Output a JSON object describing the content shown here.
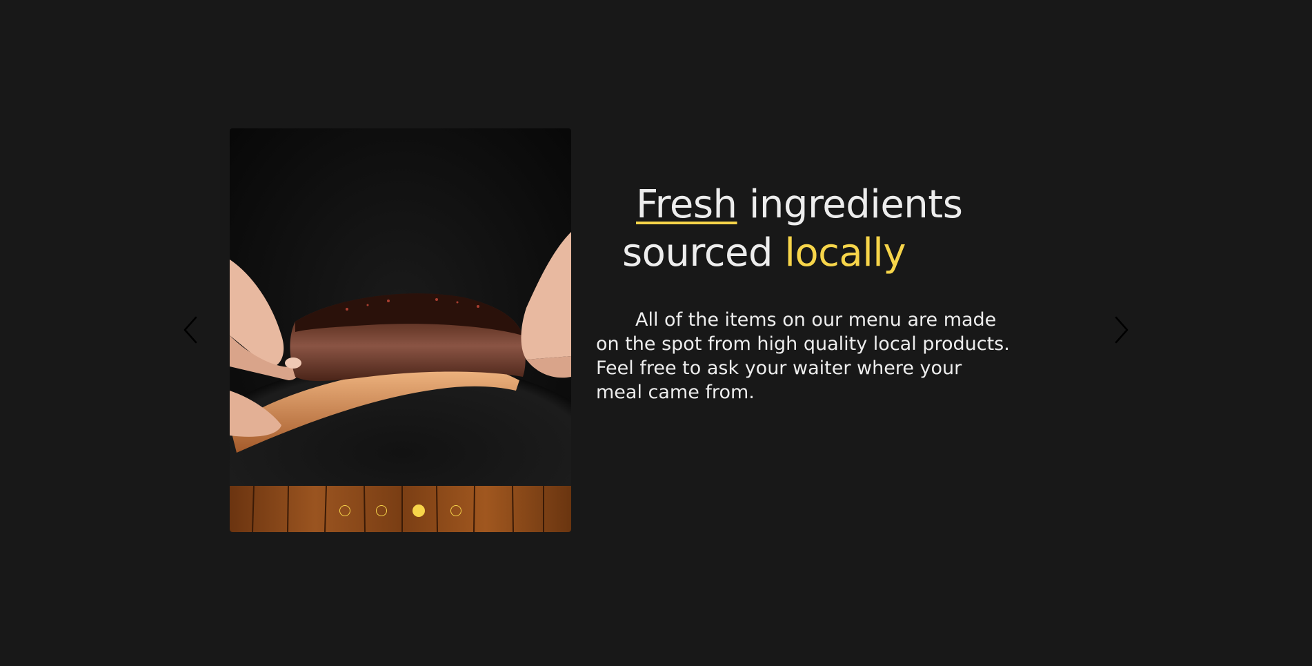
{
  "slide": {
    "image_alt": "Hands holding smoked beef rib over wooden table",
    "dots": [
      {
        "active": false
      },
      {
        "active": false
      },
      {
        "active": true
      },
      {
        "active": false
      }
    ]
  },
  "headline": {
    "word_underlined": "Fresh",
    "rest_line1": " ingredients",
    "line2_start": "sourced ",
    "word_highlight": "locally"
  },
  "body": "All of the items on our menu are made on the spot from high quality local products. Feel free to ask your waiter where your meal came from.",
  "icons": {
    "prev": "chevron-left-icon",
    "next": "chevron-right-icon"
  },
  "colors": {
    "background": "#181818",
    "accent": "#f7d54a",
    "text": "#ededed"
  }
}
